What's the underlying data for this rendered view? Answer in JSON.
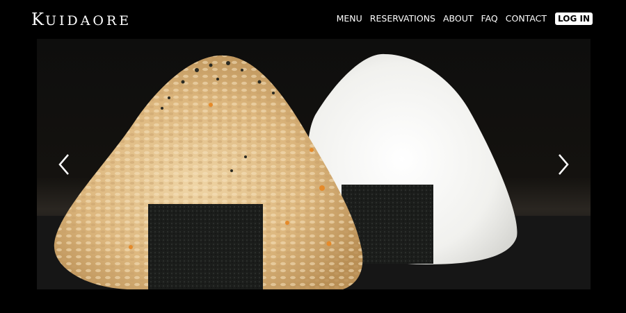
{
  "brand": {
    "first_letter": "K",
    "rest": "UIDAORE"
  },
  "nav": {
    "items": [
      {
        "label": "MENU"
      },
      {
        "label": "RESERVATIONS"
      },
      {
        "label": "ABOUT"
      },
      {
        "label": "FAQ"
      },
      {
        "label": "CONTACT"
      }
    ],
    "login_label": "LOG IN"
  },
  "carousel": {
    "prev_icon": "chevron-left-icon",
    "next_icon": "chevron-right-icon",
    "slide_subject": "onigiri"
  },
  "colors": {
    "background": "#000000",
    "text": "#ffffff",
    "login_bg": "#ffffff",
    "login_text": "#000000"
  }
}
